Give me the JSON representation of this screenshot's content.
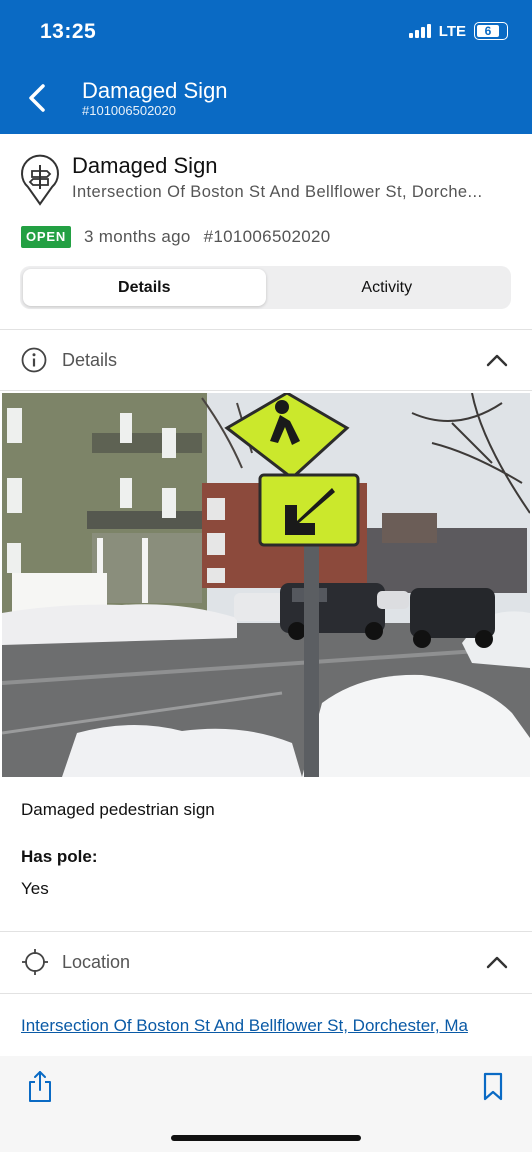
{
  "status_bar": {
    "time": "13:25",
    "network": "LTE",
    "battery": "6"
  },
  "header": {
    "title": "Damaged Sign",
    "subtitle": "#101006502020"
  },
  "issue": {
    "title": "Damaged Sign",
    "address": "Intersection Of Boston St And Bellflower St, Dorche...",
    "status": "OPEN",
    "age": "3 months ago",
    "id": "#101006502020"
  },
  "tabs": [
    {
      "label": "Details",
      "active": true
    },
    {
      "label": "Activity",
      "active": false
    }
  ],
  "details_section": {
    "label": "Details",
    "description": "Damaged pedestrian sign",
    "fields": [
      {
        "label": "Has pole:",
        "value": "Yes"
      }
    ]
  },
  "location_section": {
    "label": "Location",
    "address_link": "Intersection Of Boston St And Bellflower St, Dorchester, Ma"
  },
  "icons": {
    "back": "chevron-left-icon",
    "pin": "map-pin-icon",
    "info": "info-icon",
    "collapse": "chevron-up-icon",
    "location": "crosshair-icon",
    "share": "share-icon",
    "bookmark": "bookmark-icon"
  },
  "colors": {
    "header": "#0a6ac4",
    "open_badge": "#23a043",
    "link": "#0a5aa6",
    "sign": "#cbe82c"
  }
}
